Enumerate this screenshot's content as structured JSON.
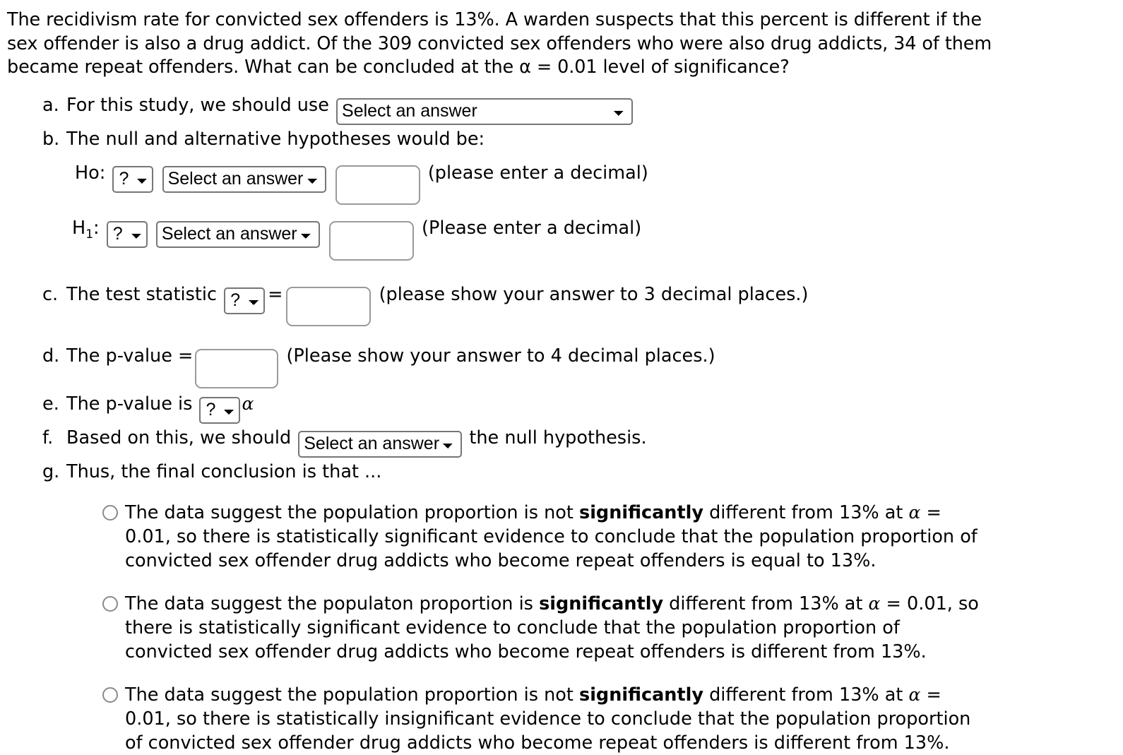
{
  "intro": {
    "text": "The recidivism rate for convicted sex offenders is 13%.  A warden suspects that this percent is different if the sex offender is also a drug addict. Of the 309 convicted sex offenders who were also drug addicts, 34 of them became repeat offenders. What can be concluded at the α = 0.01 level of significance?"
  },
  "items": {
    "a": {
      "marker": "a.",
      "label": "For this study, we should use",
      "select_value": "Select an answer"
    },
    "b": {
      "marker": "b.",
      "label": "The null and alternative hypotheses would be:",
      "ho": {
        "name": "Ho:",
        "param_select": "?",
        "operator_select": "Select an answer",
        "value": "",
        "note": "(please enter a decimal)"
      },
      "h1": {
        "name": "H",
        "subscript": "1",
        "colon": ":",
        "param_select": "?",
        "operator_select": "Select an answer",
        "value": "",
        "note": "(Please enter a decimal)"
      }
    },
    "c": {
      "marker": "c.",
      "label": "The test statistic",
      "stat_select": "?",
      "equals": "=",
      "value": "",
      "note": "(please show your answer to 3 decimal places.)"
    },
    "d": {
      "marker": "d.",
      "label": "The p-value =",
      "value": "",
      "note": "(Please show your answer to 4 decimal places.)"
    },
    "e": {
      "marker": "e.",
      "label": "The p-value is",
      "compare_select": "?",
      "alpha": "α"
    },
    "f": {
      "marker": "f.",
      "label_before": "Based on this, we should",
      "decision_select": "Select an answer",
      "label_after": "the null hypothesis."
    },
    "g": {
      "marker": "g.",
      "label": "Thus, the final conclusion is that ..."
    }
  },
  "conclusion_options": [
    {
      "id": "option-1",
      "part1": "The data suggest the population proportion is not ",
      "bold": "significantly",
      "part2": " different from 13% at ",
      "alpha": "α",
      "part3": " = 0.01, so there is statistically significant evidence to conclude that the population proportion of convicted sex offender drug addicts who become repeat offenders is equal to 13%."
    },
    {
      "id": "option-2",
      "part1": "The data suggest the populaton proportion is ",
      "bold": "significantly",
      "part2": " different from 13% at ",
      "alpha": "α",
      "part3": " = 0.01, so there is statistically significant evidence to conclude that the population proportion of convicted sex offender drug addicts who become repeat offenders is different from 13%."
    },
    {
      "id": "option-3",
      "part1": "The data suggest the population proportion is not ",
      "bold": "significantly",
      "part2": " different from 13% at ",
      "alpha": "α",
      "part3": " = 0.01, so there is statistically insignificant evidence to conclude that the population proportion of convicted sex offender drug addicts who become repeat offenders is different from 13%."
    }
  ],
  "colors": {
    "text": "#000000",
    "select_border": "#767676",
    "input_border": "#9a9a9a",
    "radio_border": "#8a8a8a",
    "background": "#ffffff"
  }
}
